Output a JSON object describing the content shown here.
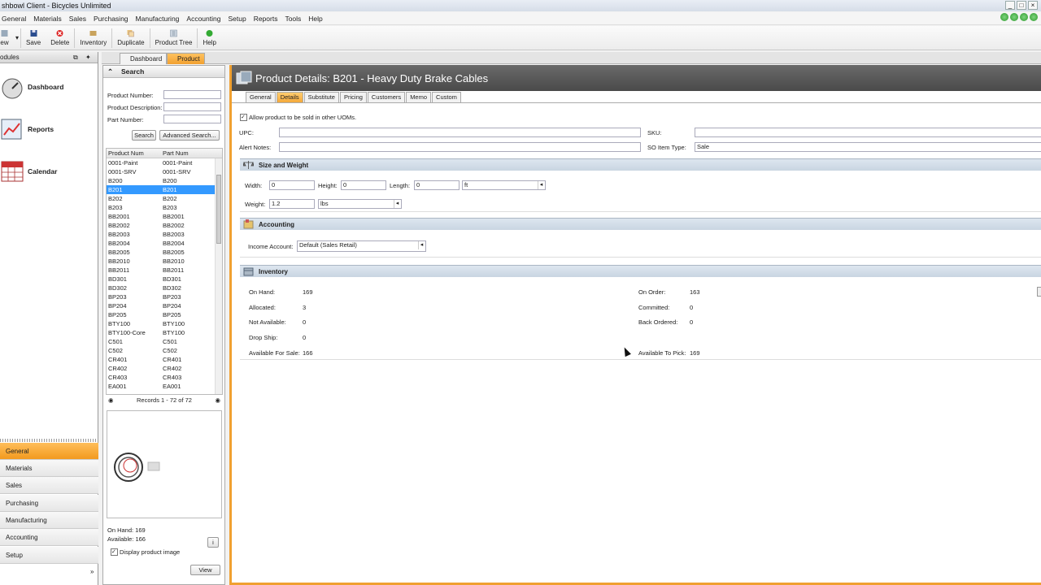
{
  "window": {
    "title": "shbowl Client - Bicycles Unlimited"
  },
  "menu": [
    "General",
    "Materials",
    "Sales",
    "Purchasing",
    "Manufacturing",
    "Accounting",
    "Setup",
    "Reports",
    "Tools",
    "Help"
  ],
  "toolbar": {
    "new": "ew",
    "save": "Save",
    "delete": "Delete",
    "inventory": "Inventory",
    "duplicate": "Duplicate",
    "product_tree": "Product Tree",
    "help": "Help"
  },
  "modules": {
    "header": "odules",
    "items": [
      "Dashboard",
      "Reports",
      "Calendar"
    ]
  },
  "sidenav": [
    "General",
    "Materials",
    "Sales",
    "Purchasing",
    "Manufacturing",
    "Accounting",
    "Setup"
  ],
  "tabs": {
    "dashboard": "Dashboard",
    "product": "Product"
  },
  "search": {
    "title": "Search",
    "product_number_label": "Product Number:",
    "product_description_label": "Product Description:",
    "part_number_label": "Part Number:",
    "search_button": "Search",
    "advanced_button": "Advanced Search...",
    "col_product": "Product Num",
    "col_part": "Part Num",
    "rows": [
      [
        "0001-Paint",
        "0001-Paint"
      ],
      [
        "0001-SRV",
        "0001-SRV"
      ],
      [
        "B200",
        "B200"
      ],
      [
        "B201",
        "B201"
      ],
      [
        "B202",
        "B202"
      ],
      [
        "B203",
        "B203"
      ],
      [
        "BB2001",
        "BB2001"
      ],
      [
        "BB2002",
        "BB2002"
      ],
      [
        "BB2003",
        "BB2003"
      ],
      [
        "BB2004",
        "BB2004"
      ],
      [
        "BB2005",
        "BB2005"
      ],
      [
        "BB2010",
        "BB2010"
      ],
      [
        "BB2011",
        "BB2011"
      ],
      [
        "BD301",
        "BD301"
      ],
      [
        "BD302",
        "BD302"
      ],
      [
        "BP203",
        "BP203"
      ],
      [
        "BP204",
        "BP204"
      ],
      [
        "BP205",
        "BP205"
      ],
      [
        "BTY100",
        "BTY100"
      ],
      [
        "BTY100-Core",
        "BTY100"
      ],
      [
        "C501",
        "C501"
      ],
      [
        "C502",
        "C502"
      ],
      [
        "CR401",
        "CR401"
      ],
      [
        "CR402",
        "CR402"
      ],
      [
        "CR403",
        "CR403"
      ],
      [
        "EA001",
        "EA001"
      ]
    ],
    "selected_index": 3,
    "records": "Records 1 - 72 of 72",
    "on_hand": "On Hand: 169",
    "available": "Available: 166",
    "display_image": "Display product image",
    "view_button": "View"
  },
  "details": {
    "title": "Product Details: B201 - Heavy Duty Brake Cables",
    "subtabs": [
      "General",
      "Details",
      "Substitute",
      "Pricing",
      "Customers",
      "Memo",
      "Custom"
    ],
    "active_subtab": 1,
    "allow_uom": "Allow product to be sold in other UOMs.",
    "upc_label": "UPC:",
    "upc_value": "",
    "sku_label": "SKU:",
    "sku_value": "",
    "alert_label": "Alert Notes:",
    "alert_value": "",
    "so_type_label": "SO Item Type:",
    "so_type_value": "Sale",
    "size_section": "Size and Weight",
    "width_label": "Width:",
    "width_value": "0",
    "height_label": "Height:",
    "height_value": "0",
    "length_label": "Length:",
    "length_value": "0",
    "dim_unit": "ft",
    "weight_label": "Weight:",
    "weight_value": "1.2",
    "weight_unit": "lbs",
    "accounting_section": "Accounting",
    "income_label": "Income Account:",
    "income_value": "Default (Sales Retail)",
    "inventory_section": "Inventory",
    "on_hand_label": "On Hand:",
    "on_hand_value": "169",
    "allocated_label": "Allocated:",
    "allocated_value": "3",
    "not_available_label": "Not Available:",
    "not_available_value": "0",
    "drop_ship_label": "Drop Ship:",
    "drop_ship_value": "0",
    "available_sale_label": "Available For Sale:",
    "available_sale_value": "166",
    "on_order_label": "On Order:",
    "on_order_value": "163",
    "committed_label": "Committed:",
    "committed_value": "0",
    "back_ordered_label": "Back Ordered:",
    "back_ordered_value": "0",
    "available_pick_label": "Available To Pick:",
    "available_pick_value": "169"
  }
}
